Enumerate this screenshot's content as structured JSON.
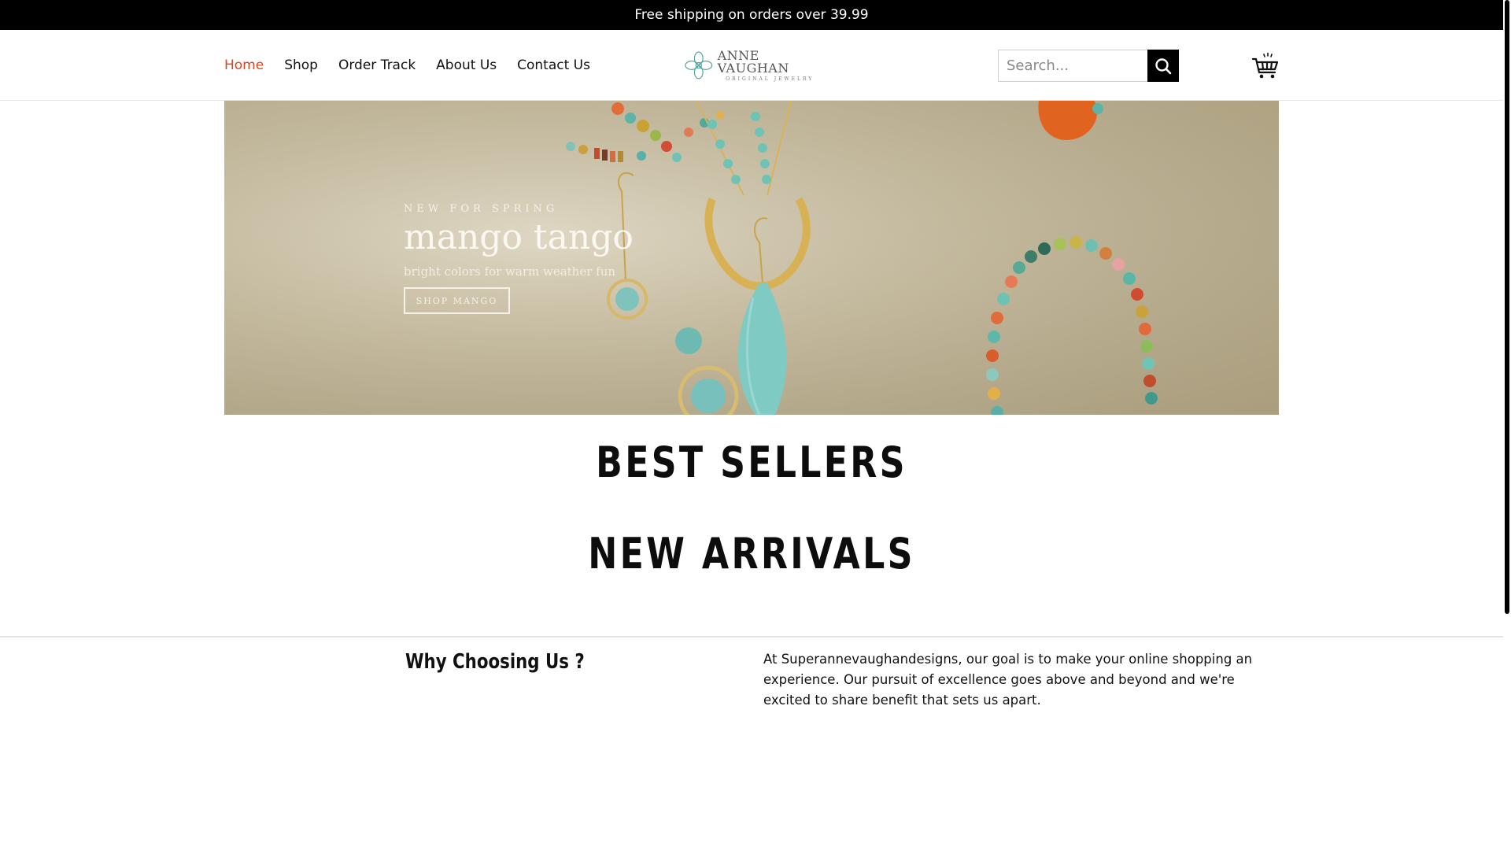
{
  "announcement": {
    "text": "Free shipping on orders over 39.99"
  },
  "nav": {
    "items": [
      {
        "label": "Home",
        "active": true
      },
      {
        "label": "Shop",
        "active": false
      },
      {
        "label": "Order Track",
        "active": false
      },
      {
        "label": "About Us",
        "active": false
      },
      {
        "label": "Contact Us",
        "active": false
      }
    ]
  },
  "logo": {
    "main": "ANNE VAUGHAN",
    "sub": "ORIGINAL JEWELRY"
  },
  "search": {
    "placeholder": "Search...",
    "icon": "search-icon"
  },
  "cart": {
    "icon": "cart-icon"
  },
  "hero": {
    "kicker": "NEW FOR SPRING",
    "title": "mango tango",
    "subtitle": "bright colors for warm weather fun",
    "button_label": "SHOP MANGO"
  },
  "sections": {
    "best_sellers": "BEST SELLERS",
    "new_arrivals": "NEW ARRIVALS"
  },
  "why": {
    "title": "Why Choosing Us ?",
    "text": "At Superannevaughandesigns, our goal is to make your online shopping an experience. Our pursuit of excellence goes above and beyond and we're excited to share benefit that sets us apart."
  },
  "colors": {
    "accent": "#e0431e",
    "topbar_bg": "#000000",
    "text": "#111111"
  }
}
